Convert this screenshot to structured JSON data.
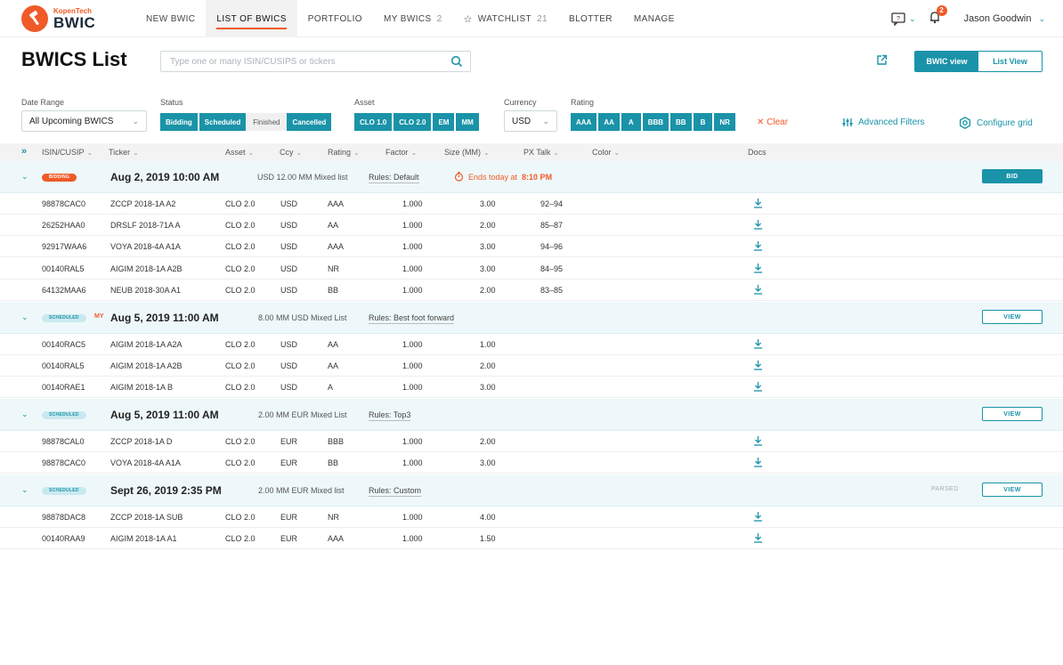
{
  "header": {
    "logo_small": "KopenTech",
    "logo_big": "BWIC",
    "nav": [
      {
        "label": "NEW BWIC",
        "count": ""
      },
      {
        "label": "LIST OF BWICS",
        "count": ""
      },
      {
        "label": "PORTFOLIO",
        "count": ""
      },
      {
        "label": "MY BWICS",
        "count": "2"
      },
      {
        "label": "WATCHLIST",
        "count": "21"
      },
      {
        "label": "BLOTTER",
        "count": ""
      },
      {
        "label": "MANAGE",
        "count": ""
      }
    ],
    "notifications_count": "2",
    "user_name": "Jason Goodwin"
  },
  "page": {
    "title": "BWICS List",
    "search_placeholder": "Type one or many ISIN/CUSIPS or tickers",
    "view_bwic": "BWIC view",
    "view_list": "List View"
  },
  "filters": {
    "date_range": {
      "label": "Date Range",
      "value": "All Upcoming BWICS"
    },
    "status": {
      "label": "Status",
      "options": [
        "Bidding",
        "Scheduled",
        "Finished",
        "Cancelled"
      ]
    },
    "asset": {
      "label": "Asset",
      "options": [
        "CLO 1.0",
        "CLO 2.0",
        "EM",
        "MM"
      ]
    },
    "currency": {
      "label": "Currency",
      "value": "USD"
    },
    "rating": {
      "label": "Rating",
      "options": [
        "AAA",
        "AA",
        "A",
        "BBB",
        "BB",
        "B",
        "NR"
      ]
    },
    "clear": "Clear",
    "advanced": "Advanced Filters",
    "configure": "Configure grid"
  },
  "columns": [
    "ISIN/CUSIP",
    "Ticker",
    "Asset",
    "Ccy",
    "Rating",
    "Factor",
    "Size (MM)",
    "PX Talk",
    "Color",
    "Docs"
  ],
  "groups": [
    {
      "status": "BIDDING",
      "my": "",
      "date": "Aug 2, 2019 10:00 AM",
      "size": "USD 12.00 MM Mixed list",
      "rules": "Rules: Default",
      "ends_prefix": "Ends today at",
      "ends_time": "8:10 PM",
      "parsed": "",
      "action": "BID",
      "rows": [
        {
          "isin": "98878CAC0",
          "ticker": "ZCCP 2018-1A A2",
          "asset": "CLO 2.0",
          "ccy": "USD",
          "rating": "AAA",
          "factor": "1.000",
          "size": "3.00",
          "px": "92–94"
        },
        {
          "isin": "26252HAA0",
          "ticker": "DRSLF 2018-71A A",
          "asset": "CLO 2.0",
          "ccy": "USD",
          "rating": "AA",
          "factor": "1.000",
          "size": "2.00",
          "px": "85–87"
        },
        {
          "isin": "92917WAA6",
          "ticker": "VOYA 2018-4A A1A",
          "asset": "CLO 2.0",
          "ccy": "USD",
          "rating": "AAA",
          "factor": "1.000",
          "size": "3.00",
          "px": "94–96"
        },
        {
          "isin": "00140RAL5",
          "ticker": "AIGIM 2018-1A A2B",
          "asset": "CLO 2.0",
          "ccy": "USD",
          "rating": "NR",
          "factor": "1.000",
          "size": "3.00",
          "px": "84–95"
        },
        {
          "isin": "64132MAA6",
          "ticker": "NEUB 2018-30A A1",
          "asset": "CLO 2.0",
          "ccy": "USD",
          "rating": "BB",
          "factor": "1.000",
          "size": "2.00",
          "px": "83–85"
        }
      ]
    },
    {
      "status": "SCHEDULED",
      "my": "MY",
      "date": "Aug 5, 2019 11:00 AM",
      "size": "8.00 MM USD Mixed List",
      "rules": "Rules: Best foot forward",
      "ends_prefix": "",
      "ends_time": "",
      "parsed": "",
      "action": "VIEW",
      "rows": [
        {
          "isin": "00140RAC5",
          "ticker": "AIGIM 2018-1A A2A",
          "asset": "CLO 2.0",
          "ccy": "USD",
          "rating": "AA",
          "factor": "1.000",
          "size": "1.00",
          "px": ""
        },
        {
          "isin": "00140RAL5",
          "ticker": "AIGIM 2018-1A A2B",
          "asset": "CLO 2.0",
          "ccy": "USD",
          "rating": "AA",
          "factor": "1.000",
          "size": "2.00",
          "px": ""
        },
        {
          "isin": "00140RAE1",
          "ticker": "AIGIM 2018-1A B",
          "asset": "CLO 2.0",
          "ccy": "USD",
          "rating": "A",
          "factor": "1.000",
          "size": "3.00",
          "px": ""
        }
      ]
    },
    {
      "status": "SCHEDULED",
      "my": "",
      "date": "Aug 5, 2019 11:00 AM",
      "size": "2.00 MM EUR Mixed List",
      "rules": "Rules: Top3",
      "ends_prefix": "",
      "ends_time": "",
      "parsed": "",
      "action": "VIEW",
      "rows": [
        {
          "isin": "98878CAL0",
          "ticker": "ZCCP 2018-1A D",
          "asset": "CLO 2.0",
          "ccy": "EUR",
          "rating": "BBB",
          "factor": "1.000",
          "size": "2.00",
          "px": ""
        },
        {
          "isin": "98878CAC0",
          "ticker": "VOYA 2018-4A A1A",
          "asset": "CLO 2.0",
          "ccy": "EUR",
          "rating": "BB",
          "factor": "1.000",
          "size": "3.00",
          "px": ""
        }
      ]
    },
    {
      "status": "SCHEDULED",
      "my": "",
      "date": "Sept 26, 2019 2:35 PM",
      "size": "2.00 MM EUR Mixed list",
      "rules": "Rules: Custom",
      "ends_prefix": "",
      "ends_time": "",
      "parsed": "PARSED",
      "action": "VIEW",
      "rows": [
        {
          "isin": "98878DAC8",
          "ticker": "ZCCP 2018-1A SUB",
          "asset": "CLO 2.0",
          "ccy": "EUR",
          "rating": "NR",
          "factor": "1.000",
          "size": "4.00",
          "px": ""
        },
        {
          "isin": "00140RAA9",
          "ticker": "AIGIM 2018-1A A1",
          "asset": "CLO 2.0",
          "ccy": "EUR",
          "rating": "AAA",
          "factor": "1.000",
          "size": "1.50",
          "px": ""
        }
      ]
    }
  ],
  "colors": {
    "accent": "#1a93a8",
    "orange": "#f05a28"
  }
}
